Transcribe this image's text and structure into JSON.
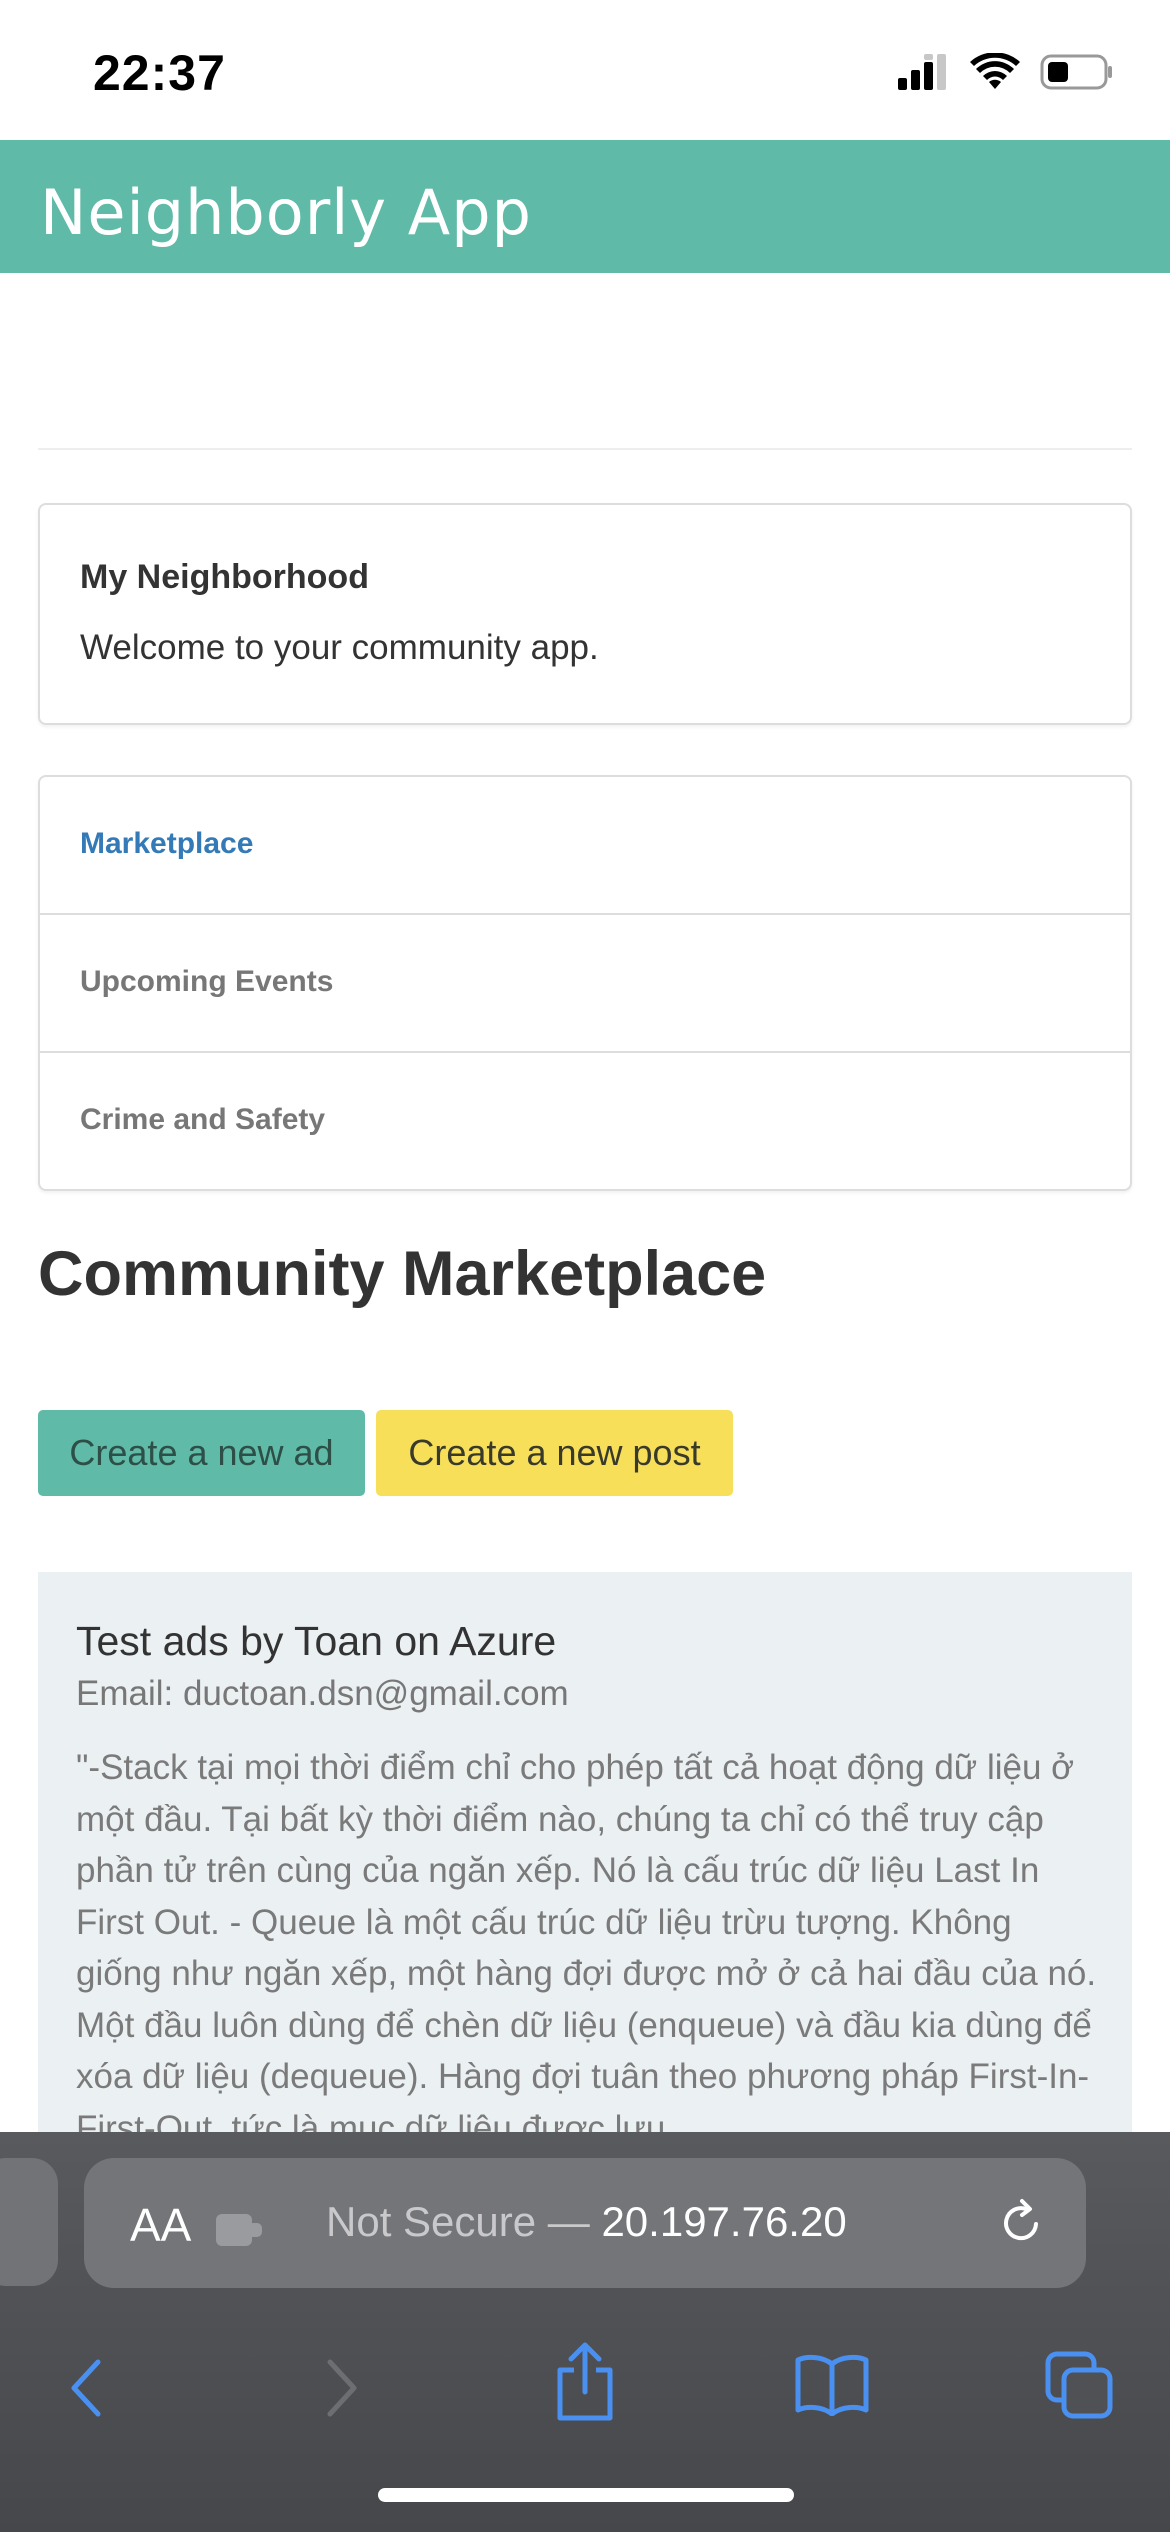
{
  "status_bar": {
    "time": "22:37"
  },
  "navbar": {
    "brand": "Neighborly App"
  },
  "panel": {
    "title": "My Neighborhood",
    "text": "Welcome to your community app."
  },
  "nav_list": [
    {
      "label": "Marketplace",
      "active": true
    },
    {
      "label": "Upcoming Events",
      "active": false
    },
    {
      "label": "Crime and Safety",
      "active": false
    }
  ],
  "page_heading": "Community Marketplace",
  "buttons": {
    "new_ad": "Create a new ad",
    "new_post": "Create a new post"
  },
  "ad": {
    "title": "Test ads by Toan on Azure",
    "email": "Email: ductoan.dsn@gmail.com",
    "body": "\"-Stack tại mọi thời điểm chỉ cho phép tất cả hoạt động dữ liệu ở một đầu. Tại bất kỳ thời điểm nào, chúng ta chỉ có thể truy cập phần tử trên cùng của ngăn xếp. Nó là cấu trúc dữ liệu Last In First Out. - Queue là một cấu trúc dữ liệu trừu tượng. Không giống như ngăn xếp, một hàng đợi được mở ở cả hai đầu của nó. Một đầu luôn dùng để chèn dữ liệu (enqueue) và đầu kia dùng để xóa dữ liệu (dequeue). Hàng đợi tuân theo phương pháp First-In-First-Out, tức là mục dữ liệu được lưu"
  },
  "safari": {
    "text_size_label": "AA",
    "url_prefix": "Not Secure — ",
    "url_host": "20.197.76.20"
  },
  "colors": {
    "navbar": "#5fbaa7",
    "btn_green": "#5fbaa7",
    "btn_yellow": "#f7df5a",
    "link_active": "#337ab7",
    "safari_icon": "#4a90f0"
  }
}
